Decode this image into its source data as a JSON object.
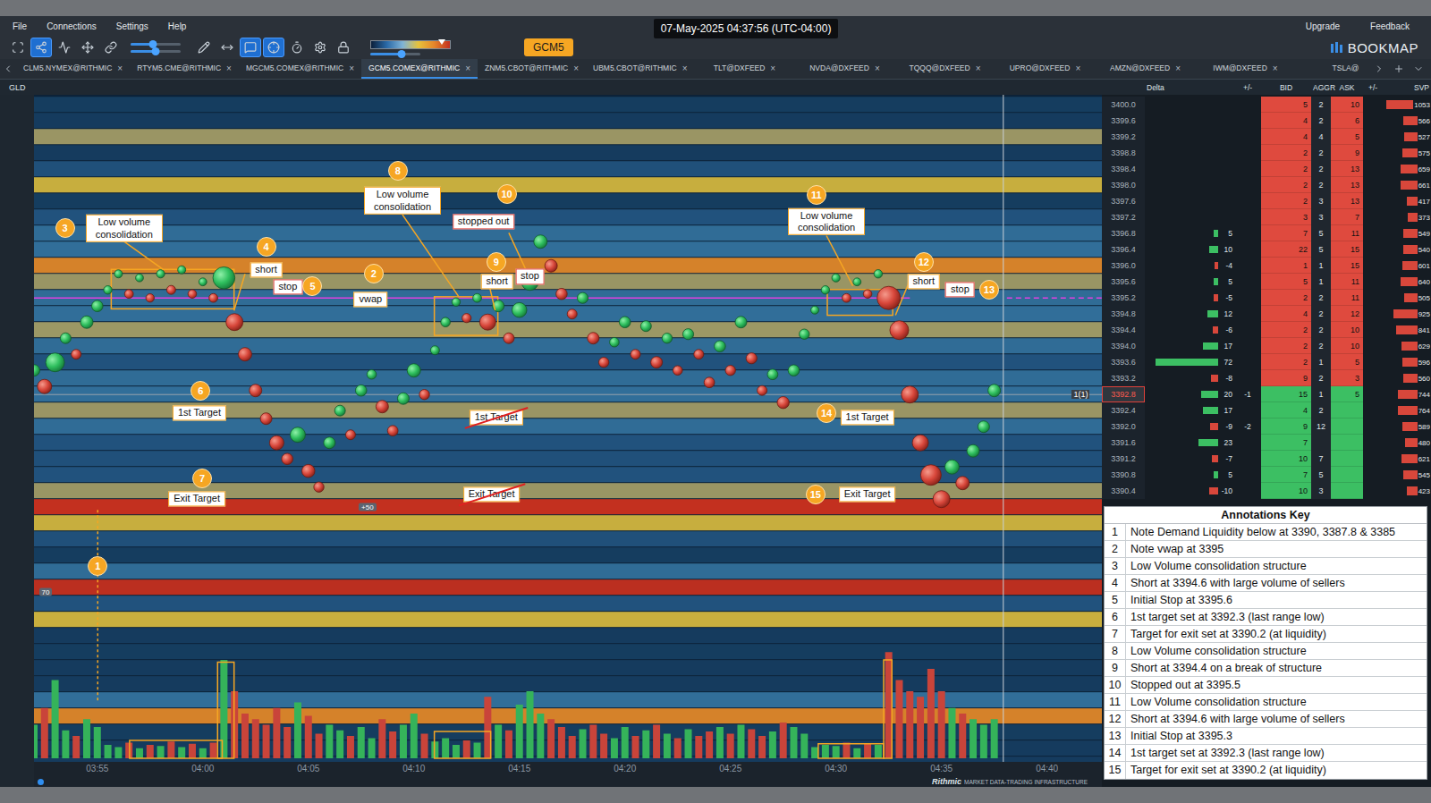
{
  "window": {
    "timestamp": "07-May-2025 04:37:56 (UTC-04:00)"
  },
  "menu": {
    "items": [
      "File",
      "Connections",
      "Settings",
      "Help"
    ],
    "right": [
      "Upgrade",
      "Feedback"
    ]
  },
  "toolbar": {
    "tools": [
      {
        "selected": false
      },
      {
        "selected": true
      },
      {
        "selected": false
      },
      {
        "selected": false
      },
      {
        "selected": false
      },
      {
        "selected": false
      },
      {
        "selected": false
      },
      {
        "selected": true
      },
      {
        "selected": true
      },
      {
        "selected": false
      },
      {
        "selected": false
      },
      {
        "selected": false
      }
    ],
    "sliders": [
      {
        "level": 0.45
      },
      {
        "level": 0.5
      },
      {
        "level": 0.62
      }
    ],
    "gradient": {
      "level": 0.9
    },
    "instrument": "GCM5",
    "logo": "BOOKMAP"
  },
  "tabs": [
    {
      "label": "CLM5.NYMEX@RITHMIC",
      "selected": false,
      "close": "×"
    },
    {
      "label": "RTYM5.CME@RITHMIC",
      "selected": false,
      "close": "×"
    },
    {
      "label": "MGCM5.COMEX@RITHMIC",
      "selected": false,
      "close": "×"
    },
    {
      "label": "GCM5.COMEX@RITHMIC",
      "selected": true,
      "close": "×"
    },
    {
      "label": "ZNM5.CBOT@RITHMIC",
      "selected": false,
      "close": "×"
    },
    {
      "label": "UBM5.CBOT@RITHMIC",
      "selected": false,
      "close": "×"
    },
    {
      "label": "TLT@DXFEED",
      "selected": false,
      "close": "×"
    },
    {
      "label": "NVDA@DXFEED",
      "selected": false,
      "close": "×"
    },
    {
      "label": "TQQQ@DXFEED",
      "selected": false,
      "close": "×"
    },
    {
      "label": "UPRO@DXFEED",
      "selected": false,
      "close": "×"
    },
    {
      "label": "AMZN@DXFEED",
      "selected": false,
      "close": "×"
    },
    {
      "label": "IWM@DXFEED",
      "selected": false,
      "close": "×"
    },
    {
      "label": "TSLA@",
      "selected": false
    }
  ],
  "subheader": {
    "symbol": "GLD",
    "columns": [
      "Delta",
      "+/-",
      "BID",
      "AGGR",
      "ASK",
      "+/-",
      "SVP"
    ]
  },
  "chart": {
    "x_domain": [
      0,
      50.6
    ],
    "y_domain": [
      3383.67,
      3400.25
    ],
    "ticks": [
      {
        "label": "03:55",
        "t": 3
      },
      {
        "label": "04:00",
        "t": 8
      },
      {
        "label": "04:05",
        "t": 13
      },
      {
        "label": "04:10",
        "t": 18
      },
      {
        "label": "04:15",
        "t": 23
      },
      {
        "label": "04:20",
        "t": 28
      },
      {
        "label": "04:25",
        "t": 33
      },
      {
        "label": "04:30",
        "t": 38
      },
      {
        "label": "04:35",
        "t": 43
      },
      {
        "label": "04:40",
        "t": 48
      }
    ],
    "t_step": 0.5,
    "prices": [
      3393.4,
      3393.0,
      3393.6,
      3394.2,
      3393.8,
      3394.6,
      3395.0,
      3395.4,
      3395.8,
      3395.3,
      3395.7,
      3395.2,
      3395.8,
      3395.4,
      3395.9,
      3395.3,
      3395.6,
      3395.2,
      3395.7,
      3394.6,
      3393.8,
      3392.9,
      3392.2,
      3391.6,
      3391.2,
      3391.8,
      3390.9,
      3390.5,
      3391.6,
      3392.4,
      3391.8,
      3392.9,
      3393.3,
      3392.5,
      3391.9,
      3392.7,
      3393.4,
      3392.8,
      3393.9,
      3394.6,
      3395.1,
      3394.7,
      3395.2,
      3394.6,
      3395.0,
      3394.2,
      3394.9,
      3395.6,
      3396.6,
      3396.0,
      3395.3,
      3394.8,
      3395.2,
      3394.2,
      3393.6,
      3394.1,
      3394.6,
      3393.8,
      3394.5,
      3393.6,
      3394.2,
      3393.4,
      3394.3,
      3393.8,
      3393.1,
      3394.0,
      3393.4,
      3394.6,
      3393.7,
      3392.9,
      3393.3,
      3392.6,
      3393.4,
      3394.3,
      3394.9,
      3395.4,
      3395.7,
      3395.2,
      3395.6,
      3395.3,
      3395.8,
      3395.2,
      3394.4,
      3392.8,
      3391.6,
      3390.8,
      3390.2,
      3391.0,
      3390.6,
      3391.4,
      3392.0,
      3392.9
    ],
    "volumes": [
      30,
      45,
      70,
      25,
      20,
      35,
      28,
      12,
      10,
      14,
      9,
      12,
      11,
      15,
      10,
      13,
      9,
      14,
      88,
      60,
      40,
      35,
      30,
      45,
      28,
      50,
      38,
      22,
      30,
      25,
      20,
      28,
      18,
      35,
      24,
      30,
      40,
      22,
      15,
      18,
      12,
      16,
      14,
      55,
      30,
      25,
      48,
      60,
      40,
      35,
      28,
      20,
      26,
      30,
      22,
      18,
      28,
      20,
      25,
      30,
      22,
      18,
      26,
      20,
      24,
      28,
      22,
      30,
      26,
      20,
      24,
      32,
      28,
      22,
      10,
      12,
      11,
      14,
      9,
      13,
      12,
      95,
      70,
      60,
      55,
      80,
      60,
      45,
      40,
      35,
      30,
      35
    ],
    "liquidity": [
      {
        "price": 3400.0,
        "level": 0.35
      },
      {
        "price": 3399.6,
        "level": 0.3
      },
      {
        "price": 3399.2,
        "level": 0.62
      },
      {
        "price": 3398.8,
        "level": 0.3
      },
      {
        "price": 3398.4,
        "level": 0.4
      },
      {
        "price": 3398.0,
        "level": 0.72
      },
      {
        "price": 3397.6,
        "level": 0.35
      },
      {
        "price": 3397.2,
        "level": 0.45
      },
      {
        "price": 3396.8,
        "level": 0.5
      },
      {
        "price": 3396.4,
        "level": 0.55
      },
      {
        "price": 3396.0,
        "level": 0.85
      },
      {
        "price": 3395.6,
        "level": 0.6
      },
      {
        "price": 3395.2,
        "level": 0.5
      },
      {
        "price": 3394.8,
        "level": 0.55
      },
      {
        "price": 3394.4,
        "level": 0.65
      },
      {
        "price": 3394.0,
        "level": 0.5
      },
      {
        "price": 3393.6,
        "level": 0.45
      },
      {
        "price": 3393.2,
        "level": 0.5
      },
      {
        "price": 3392.8,
        "level": 0.55
      },
      {
        "price": 3392.4,
        "level": 0.62
      },
      {
        "price": 3392.0,
        "level": 0.5
      },
      {
        "price": 3391.6,
        "level": 0.45
      },
      {
        "price": 3391.2,
        "level": 0.4
      },
      {
        "price": 3390.8,
        "level": 0.45
      },
      {
        "price": 3390.4,
        "level": 0.6
      },
      {
        "price": 3390.0,
        "level": 1.0
      },
      {
        "price": 3389.6,
        "level": 0.72
      },
      {
        "price": 3389.2,
        "level": 0.4
      },
      {
        "price": 3388.8,
        "level": 0.35
      },
      {
        "price": 3388.4,
        "level": 0.5
      },
      {
        "price": 3388.0,
        "level": 0.9
      },
      {
        "price": 3387.6,
        "level": 0.45
      },
      {
        "price": 3387.2,
        "level": 0.75
      },
      {
        "price": 3386.8,
        "level": 0.3
      },
      {
        "price": 3386.4,
        "level": 0.35
      },
      {
        "price": 3386.0,
        "level": 0.3
      },
      {
        "price": 3385.6,
        "level": 0.3
      },
      {
        "price": 3385.2,
        "level": 0.55
      },
      {
        "price": 3384.8,
        "level": 0.85
      },
      {
        "price": 3384.4,
        "level": 0.35
      },
      {
        "price": 3384.0,
        "level": 0.3
      },
      {
        "price": 3383.6,
        "level": 0.3
      }
    ],
    "vwap": 3395.2,
    "last_price": 3392.8,
    "now": 45.93,
    "boxes": [
      {
        "t1": 3.66,
        "t2": 9.48,
        "p1": 3395.91,
        "p2": 3394.93
      },
      {
        "t1": 18.97,
        "t2": 21.98,
        "p1": 3395.23,
        "p2": 3394.27
      },
      {
        "t1": 37.59,
        "t2": 40.69,
        "p1": 3395.41,
        "p2": 3394.77
      }
    ],
    "volume_boxes": [
      {
        "t1": 4.53,
        "t2": 8.92,
        "volume": 16
      },
      {
        "t1": 8.7,
        "t2": 9.48,
        "volume": 86
      },
      {
        "t1": 18.97,
        "t2": 21.64,
        "volume": 24
      },
      {
        "t1": 37.16,
        "t2": 40.26,
        "volume": 13
      },
      {
        "t1": 40.26,
        "t2": 40.65,
        "volume": 88
      }
    ],
    "arrows": [
      {
        "t1": 4.27,
        "p1": 3396.6,
        "t2": 6.12,
        "p2": 3395.91,
        "dotted": false
      },
      {
        "t1": 10.0,
        "p1": 3395.8,
        "t2": 9.48,
        "p2": 3394.89,
        "dotted": false
      },
      {
        "t1": 17.46,
        "p1": 3397.27,
        "t2": 20.13,
        "p2": 3395.23,
        "dotted": false
      },
      {
        "t1": 21.6,
        "p1": 3395.45,
        "t2": 21.85,
        "p2": 3394.89,
        "dotted": false
      },
      {
        "t1": 22.5,
        "p1": 3396.82,
        "t2": 23.3,
        "p2": 3395.91,
        "dotted": false
      },
      {
        "t1": 37.55,
        "p1": 3396.75,
        "t2": 38.8,
        "p2": 3395.5,
        "dotted": false
      },
      {
        "t1": 41.47,
        "p1": 3395.6,
        "t2": 40.82,
        "p2": 3394.77,
        "dotted": false
      },
      {
        "t1": 3.02,
        "p1": 3389.93,
        "t2": 3.02,
        "p2": 3385.16,
        "dotted": true
      }
    ],
    "badges": [
      {
        "n": "1",
        "t": 3.02,
        "price": 3388.53
      },
      {
        "n": "2",
        "t": 16.1,
        "price": 3395.8
      },
      {
        "n": "3",
        "t": 1.47,
        "price": 3396.93
      },
      {
        "n": "4",
        "t": 11.0,
        "price": 3396.48
      },
      {
        "n": "5",
        "t": 13.2,
        "price": 3395.5
      },
      {
        "n": "6",
        "t": 7.9,
        "price": 3392.9
      },
      {
        "n": "7",
        "t": 7.97,
        "price": 3390.71
      },
      {
        "n": "8",
        "t": 17.24,
        "price": 3398.37
      },
      {
        "n": "9",
        "t": 21.9,
        "price": 3396.1
      },
      {
        "n": "10",
        "t": 22.4,
        "price": 3397.78
      },
      {
        "n": "11",
        "t": 37.07,
        "price": 3397.75
      },
      {
        "n": "12",
        "t": 42.16,
        "price": 3396.1
      },
      {
        "n": "13",
        "t": 45.26,
        "price": 3395.41
      },
      {
        "n": "14",
        "t": 37.55,
        "price": 3392.34
      },
      {
        "n": "15",
        "t": 37.03,
        "price": 3390.32
      }
    ],
    "labels": [
      {
        "text": "Low volume consolidation",
        "t": 4.27,
        "price": 3396.93,
        "kind": "note",
        "struck": false
      },
      {
        "text": "Low volume consolidation",
        "t": 17.46,
        "price": 3397.62,
        "kind": "note",
        "struck": false
      },
      {
        "text": "Low volume consolidation",
        "t": 37.55,
        "price": 3397.1,
        "kind": "note",
        "struck": false
      },
      {
        "text": "short",
        "t": 11.0,
        "price": 3395.9,
        "kind": "note",
        "struck": false
      },
      {
        "text": "short",
        "t": 21.94,
        "price": 3395.6,
        "kind": "note",
        "struck": false
      },
      {
        "text": "short",
        "t": 42.16,
        "price": 3395.6,
        "kind": "note",
        "struck": false
      },
      {
        "text": "stop",
        "t": 12.03,
        "price": 3395.48,
        "kind": "stop",
        "struck": false
      },
      {
        "text": "stop",
        "t": 23.5,
        "price": 3395.73,
        "kind": "stop",
        "struck": false
      },
      {
        "text": "stop",
        "t": 43.88,
        "price": 3395.41,
        "kind": "stop",
        "struck": false
      },
      {
        "text": "vwap",
        "t": 15.95,
        "price": 3395.16,
        "kind": "note",
        "struck": false
      },
      {
        "text": "stopped out",
        "t": 21.3,
        "price": 3397.09,
        "kind": "stop",
        "struck": false
      },
      {
        "text": "1st Target",
        "t": 7.84,
        "price": 3392.34,
        "kind": "note",
        "struck": false
      },
      {
        "text": "1st Target",
        "t": 21.9,
        "price": 3392.23,
        "kind": "note",
        "struck": true
      },
      {
        "text": "1st Target",
        "t": 39.48,
        "price": 3392.23,
        "kind": "note",
        "struck": false
      },
      {
        "text": "Exit Target",
        "t": 7.72,
        "price": 3390.2,
        "kind": "note",
        "struck": false
      },
      {
        "text": "Exit Target",
        "t": 21.68,
        "price": 3390.32,
        "kind": "note",
        "struck": true
      },
      {
        "text": "Exit Target",
        "t": 39.48,
        "price": 3390.32,
        "kind": "note",
        "struck": false
      }
    ],
    "tags": [
      {
        "text": "+50",
        "t": 15.3,
        "price": 3390.0
      },
      {
        "text": "70",
        "t": 0.15,
        "price": 3387.9
      }
    ],
    "position_marker": {
      "text": "1(1)",
      "t": 49.6,
      "price": 3392.8
    }
  },
  "book": {
    "rows": [
      {
        "price": "3400.0",
        "bid": "5",
        "aggr": "2",
        "ask": "10",
        "svp": "1053"
      },
      {
        "price": "3399.6",
        "bid": "4",
        "aggr": "2",
        "ask": "6",
        "svp": "566"
      },
      {
        "price": "3399.2",
        "bid": "4",
        "aggr": "4",
        "ask": "5",
        "svp": "527"
      },
      {
        "price": "3398.8",
        "bid": "2",
        "aggr": "2",
        "ask": "9",
        "svp": "575"
      },
      {
        "price": "3398.4",
        "bid": "2",
        "aggr": "2",
        "ask": "13",
        "svp": "659"
      },
      {
        "price": "3398.0",
        "bid": "2",
        "aggr": "2",
        "ask": "13",
        "svp": "661"
      },
      {
        "price": "3397.6",
        "bid": "2",
        "aggr": "3",
        "ask": "13",
        "svp": "417"
      },
      {
        "price": "3397.2",
        "bid": "3",
        "aggr": "3",
        "ask": "7",
        "svp": "373"
      },
      {
        "price": "3396.8",
        "bid": "7",
        "aggr": "5",
        "ask": "11",
        "svp": "549",
        "delta": "5"
      },
      {
        "price": "3396.4",
        "bid": "22",
        "aggr": "5",
        "ask": "15",
        "svp": "540",
        "delta": "10"
      },
      {
        "price": "3396.0",
        "bid": "1",
        "aggr": "1",
        "ask": "15",
        "svp": "601",
        "delta": "-4"
      },
      {
        "price": "3395.6",
        "bid": "5",
        "aggr": "1",
        "ask": "11",
        "svp": "640",
        "delta": "5"
      },
      {
        "price": "3395.2",
        "bid": "2",
        "aggr": "2",
        "ask": "11",
        "svp": "505",
        "delta": "-5"
      },
      {
        "price": "3394.8",
        "bid": "4",
        "aggr": "2",
        "ask": "12",
        "svp": "925",
        "delta": "12"
      },
      {
        "price": "3394.4",
        "bid": "2",
        "aggr": "2",
        "ask": "10",
        "svp": "841",
        "delta": "-6"
      },
      {
        "price": "3394.0",
        "bid": "2",
        "aggr": "2",
        "ask": "10",
        "svp": "629",
        "delta": "17"
      },
      {
        "price": "3393.6",
        "bid": "2",
        "aggr": "1",
        "ask": "5",
        "svp": "596",
        "delta": "72"
      },
      {
        "price": "3393.2",
        "bid": "9",
        "aggr": "2",
        "ask": "3",
        "svp": "560",
        "delta": "-8"
      },
      {
        "price": "3392.8",
        "bid": "15",
        "aggr": "1",
        "ask": "5",
        "svp": "744",
        "delta": "20",
        "change": "-1"
      },
      {
        "price": "3392.4",
        "bid": "4",
        "aggr": "2",
        "svp": "764",
        "delta": "17"
      },
      {
        "price": "3392.0",
        "bid": "9",
        "aggr": "12",
        "svp": "589",
        "delta": "-9",
        "change": "-2"
      },
      {
        "price": "3391.6",
        "bid": "7",
        "svp": "480",
        "delta": "23"
      },
      {
        "price": "3391.2",
        "bid": "10",
        "aggr": "7",
        "svp": "621",
        "delta": "-7"
      },
      {
        "price": "3390.8",
        "bid": "7",
        "aggr": "5",
        "svp": "545",
        "delta": "5"
      },
      {
        "price": "3390.4",
        "bid": "10",
        "aggr": "3",
        "svp": "423",
        "delta": "-10"
      }
    ]
  },
  "annotations_key": {
    "title": "Annotations Key",
    "rows": [
      {
        "n": "1",
        "text": "Note Demand Liquidity below at 3390, 3387.8 & 3385"
      },
      {
        "n": "2",
        "text": "Note vwap at 3395"
      },
      {
        "n": "3",
        "text": "Low Volume consolidation structure"
      },
      {
        "n": "4",
        "text": "Short at 3394.6 with large volume of sellers"
      },
      {
        "n": "5",
        "text": "Initial Stop at 3395.6"
      },
      {
        "n": "6",
        "text": "1st target set at 3392.3 (last range low)"
      },
      {
        "n": "7",
        "text": "Target for exit set at 3390.2 (at liquidity)"
      },
      {
        "n": "8",
        "text": "Low Volume consolidation structure"
      },
      {
        "n": "9",
        "text": "Short at 3394.4 on a break of structure"
      },
      {
        "n": "10",
        "text": "Stopped out at 3395.5"
      },
      {
        "n": "11",
        "text": "Low Volume consolidation structure"
      },
      {
        "n": "12",
        "text": "Short at 3394.6 with large volume of sellers"
      },
      {
        "n": "13",
        "text": "Initial Stop at 3395.3"
      },
      {
        "n": "14",
        "text": "1st target set at 3392.3 (last range low)"
      },
      {
        "n": "15",
        "text": "Target for exit set at 3390.2 (at liquidity)"
      }
    ]
  },
  "status_bar": {
    "brand": "Rithmic",
    "tagline": "MARKET DATA-TRADING INFRASTRUCTURE"
  }
}
